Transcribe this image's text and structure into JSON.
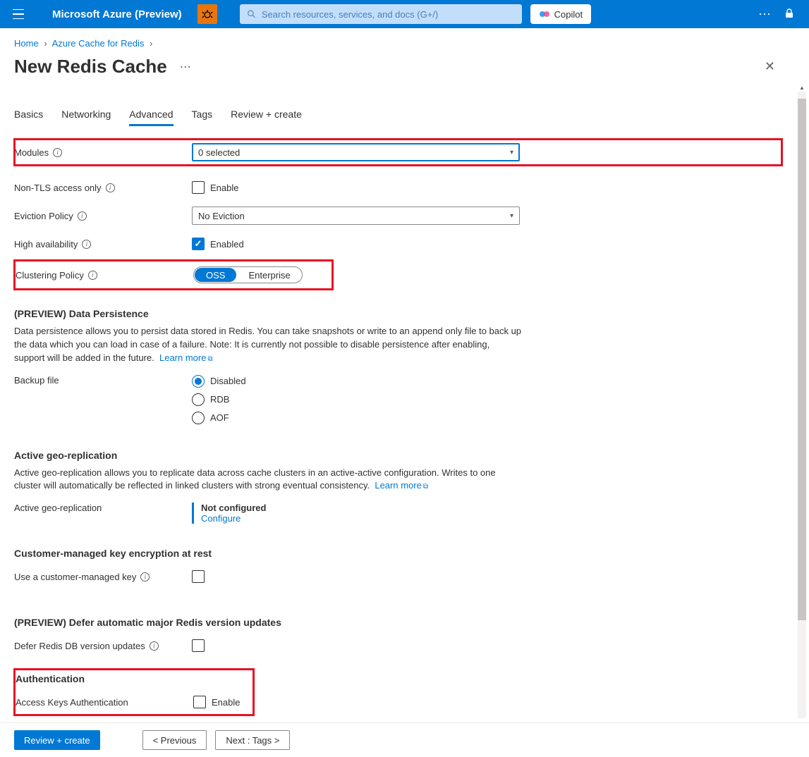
{
  "topbar": {
    "brand": "Microsoft Azure (Preview)",
    "search_placeholder": "Search resources, services, and docs (G+/)",
    "copilot": "Copilot"
  },
  "breadcrumb": {
    "home": "Home",
    "parent": "Azure Cache for Redis"
  },
  "page": {
    "title": "New Redis Cache"
  },
  "tabs": [
    "Basics",
    "Networking",
    "Advanced",
    "Tags",
    "Review + create"
  ],
  "labels": {
    "modules": "Modules",
    "nontls": "Non-TLS access only",
    "eviction": "Eviction Policy",
    "ha": "High availability",
    "clustering": "Clustering Policy",
    "backup": "Backup file",
    "activegeo_row": "Active geo-replication",
    "cmk": "Use a customer-managed key",
    "defer": "Defer Redis DB version updates",
    "accesskeys": "Access Keys Authentication",
    "enable": "Enable",
    "enabled": "Enabled"
  },
  "values": {
    "modules_selected": "0 selected",
    "eviction_selected": "No Eviction",
    "clustering_options": [
      "OSS",
      "Enterprise"
    ],
    "backup_options": [
      "Disabled",
      "RDB",
      "AOF"
    ],
    "geo_status": "Not configured",
    "geo_configure": "Configure"
  },
  "sections": {
    "persistence_head": "(PREVIEW) Data Persistence",
    "persistence_desc": "Data persistence allows you to persist data stored in Redis. You can take snapshots or write to an append only file to back up the data which you can load in case of a failure. Note: It is currently not possible to disable persistence after enabling, support will be added in the future.",
    "learn_more": "Learn more",
    "geo_head": "Active geo-replication",
    "geo_desc": "Active geo-replication allows you to replicate data across cache clusters in an active-active configuration. Writes to one cluster will automatically be reflected in linked clusters with strong eventual consistency.",
    "cmk_head": "Customer-managed key encryption at rest",
    "defer_head": "(PREVIEW) Defer automatic major Redis version updates",
    "auth_head": "Authentication"
  },
  "footer": {
    "review": "Review + create",
    "previous": "< Previous",
    "next": "Next : Tags >"
  }
}
